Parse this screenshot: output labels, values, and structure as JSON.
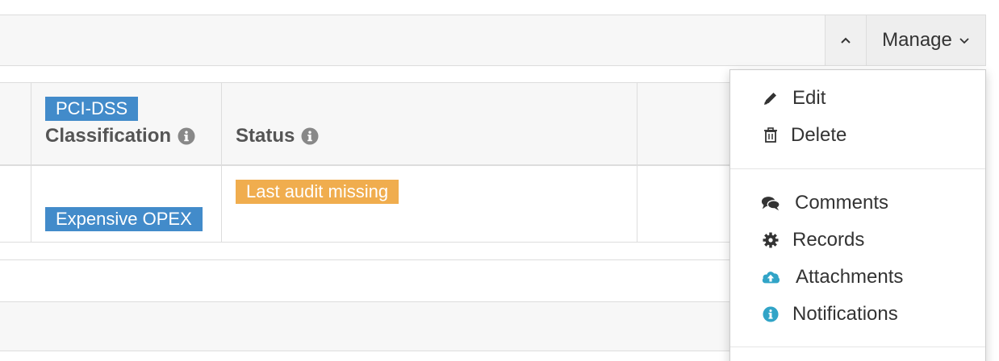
{
  "panel": {
    "collapse_icon": "chevron-up-icon",
    "manage_label": "Manage"
  },
  "table": {
    "headers": [
      {
        "label": "Classification",
        "icon": "info-circle-icon"
      },
      {
        "label": "Status",
        "icon": "info-circle-icon"
      }
    ],
    "row": {
      "classification_tags": [
        "PCI-DSS",
        "Expensive OPEX"
      ],
      "status_tags": [
        "Last audit missing"
      ]
    }
  },
  "dropdown": {
    "group1": [
      {
        "label": "Edit",
        "icon": "pencil-icon"
      },
      {
        "label": "Delete",
        "icon": "trash-icon"
      }
    ],
    "group2": [
      {
        "label": "Comments",
        "icon": "comments-icon"
      },
      {
        "label": "Records",
        "icon": "gear-icon"
      },
      {
        "label": "Attachments",
        "icon": "cloud-upload-icon"
      },
      {
        "label": "Notifications",
        "icon": "info-circle-icon"
      }
    ]
  },
  "colors": {
    "tag_blue": "#428bca",
    "tag_orange": "#f0ad4e",
    "icon_teal": "#31a4c7",
    "header_bg": "#f7f7f7",
    "border": "#dddddd"
  }
}
